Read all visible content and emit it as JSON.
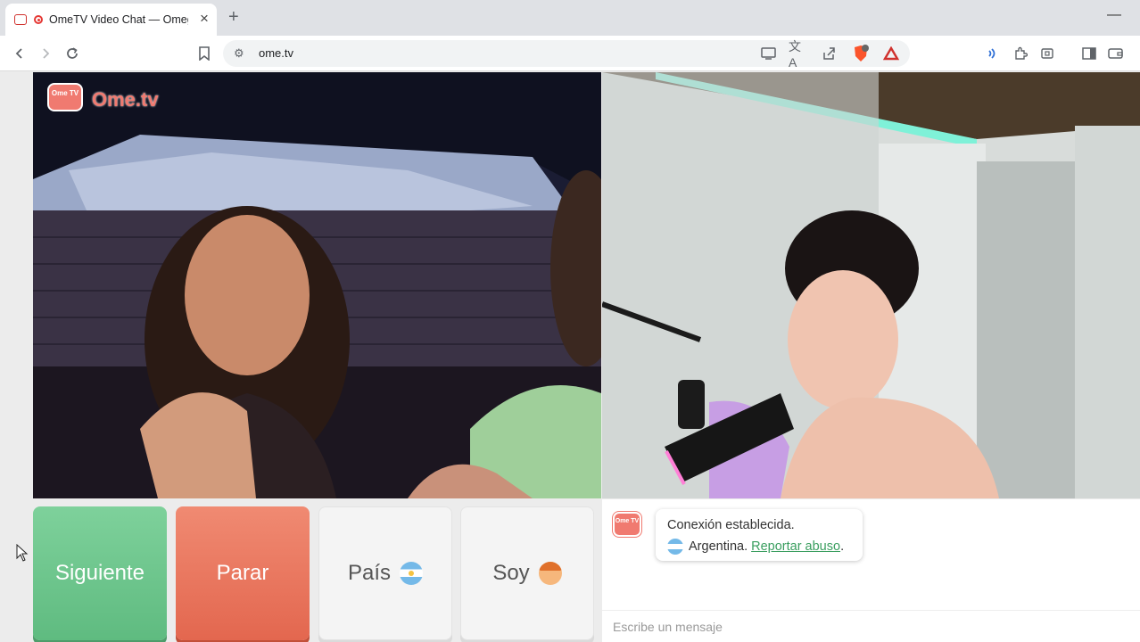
{
  "browser": {
    "tab_title": "OmeTV Video Chat — Omegle",
    "url": "ome.tv"
  },
  "left_video": {
    "logo_text": "Ome.tv",
    "logo_tv_text": "Ome TV"
  },
  "controls": {
    "next_label": "Siguiente",
    "stop_label": "Parar",
    "country_label": "País",
    "gender_label": "Soy"
  },
  "chat": {
    "logo_text": "Ome TV",
    "status_message": "Conexión establecida.",
    "country": "Argentina.",
    "report_link": "Reportar abuso",
    "report_suffix": ".",
    "input_placeholder": "Escribe un mensaje"
  },
  "colors": {
    "next_button": "#6cc68c",
    "stop_button": "#ea735b",
    "brand": "#f07a70",
    "report_link": "#3a9e5f"
  },
  "icons": [
    "back-icon",
    "forward-icon",
    "reload-icon",
    "bookmark-icon",
    "site-settings-icon",
    "cast-icon",
    "translate-icon",
    "share-icon",
    "brave-shield-icon",
    "brave-rewards-icon",
    "speaker-icon",
    "extensions-icon",
    "screenshot-icon",
    "sidebar-icon",
    "wallet-icon"
  ]
}
